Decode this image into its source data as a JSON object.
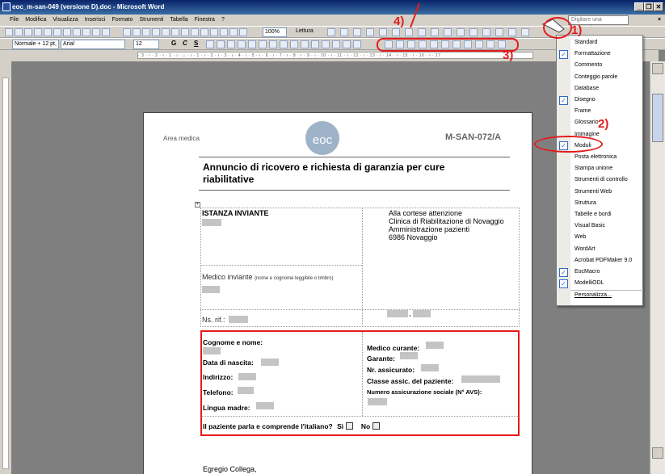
{
  "window": {
    "title": "eoc_m-san-049 (versione D).doc - Microsoft Word",
    "min": "_",
    "restore": "❐",
    "close": "✕"
  },
  "menu": {
    "items": [
      "File",
      "Modifica",
      "Visualizza",
      "Inserisci",
      "Formato",
      "Strumenti",
      "Tabella",
      "Finestra",
      "?"
    ],
    "help_placeholder": "Digitare una domanda.",
    "help_close": "×"
  },
  "toolbar1": {
    "zoom": "100%",
    "read_label": "Lettura"
  },
  "toolbar2": {
    "style": "Normale + 12 pt,",
    "font": "Arial",
    "size": "12",
    "bold": "G",
    "italic": "C",
    "underline": "S"
  },
  "ruler": {
    "marks": "· 3 · ı · 2 · ı · 1 · ı · ⌂ · ı · 1 · ı · 2 · ı · 3 · ı · 4 · ı · 5 · ı · 6 · ı · 7 · ı · 8 · ı · 9 · ı · 10 · ı · 11 · ı · 12 · ı · 13 · ı · 14 · ı · 15 · ı · 16 · ı · 17"
  },
  "annotations": {
    "a4": "4)",
    "a1": "1)",
    "a2": "2)",
    "a3": "3)"
  },
  "dropdown": {
    "items": [
      {
        "label": "Standard",
        "checked": false
      },
      {
        "label": "Formattazione",
        "checked": true
      },
      {
        "label": "Commento",
        "checked": false
      },
      {
        "label": "Conteggio parole",
        "checked": false
      },
      {
        "label": "Database",
        "checked": false
      },
      {
        "label": "Disegno",
        "checked": true
      },
      {
        "label": "Frame",
        "checked": false
      },
      {
        "label": "Glossario",
        "checked": false
      },
      {
        "label": "Immagine",
        "checked": false
      },
      {
        "label": "Moduli",
        "checked": true
      },
      {
        "label": "Posta elettronica",
        "checked": false
      },
      {
        "label": "Stampa unione",
        "checked": false
      },
      {
        "label": "Strumenti di controllo",
        "checked": false
      },
      {
        "label": "Strumenti Web",
        "checked": false
      },
      {
        "label": "Struttura",
        "checked": false
      },
      {
        "label": "Tabelle e bordi",
        "checked": false
      },
      {
        "label": "Visual Basic",
        "checked": false
      },
      {
        "label": "Web",
        "checked": false
      },
      {
        "label": "WordArt",
        "checked": false
      },
      {
        "label": "Acrobat PDFMaker 9.0",
        "checked": false
      },
      {
        "label": "EocMacro",
        "checked": true
      },
      {
        "label": "ModelliODL",
        "checked": true
      },
      {
        "label": "Personalizza...",
        "checked": false
      }
    ],
    "check_mark": "✓"
  },
  "doc": {
    "area": "Area medica",
    "logo": "eoc",
    "code": "M-SAN-072/A",
    "title": "Annuncio di ricovero e richiesta di garanzia per cure riabilitative",
    "istanza": "ISTANZA INVIANTE",
    "address": [
      "Alla cortese attenzione",
      "Clinica di Riabilitazione di Novaggio",
      "Amministrazione pazienti",
      "6986 Novaggio"
    ],
    "medico_inviante": "Medico inviante",
    "medico_inviante_note": "(nome e cognome leggibile o timbro)",
    "ns_rif": "Ns. rif.:",
    "comma": ",",
    "cognome": "Cognome e nome:",
    "data_nascita": "Data di nascita:",
    "indirizzo": "Indirizzo:",
    "telefono": "Telefono:",
    "lingua": "Lingua madre:",
    "medico_curante": "Medico curante:",
    "garante": "Garante:",
    "nr_assicurato": "Nr. assicurato:",
    "classe": "Classe assic. del paziente:",
    "avs": "Numero assicurazione sociale (N° AVS):",
    "italiano": "Il paziente parla e comprende l'italiano?",
    "si": "Sì",
    "no": "No",
    "greeting": "Egregio Collega,"
  }
}
